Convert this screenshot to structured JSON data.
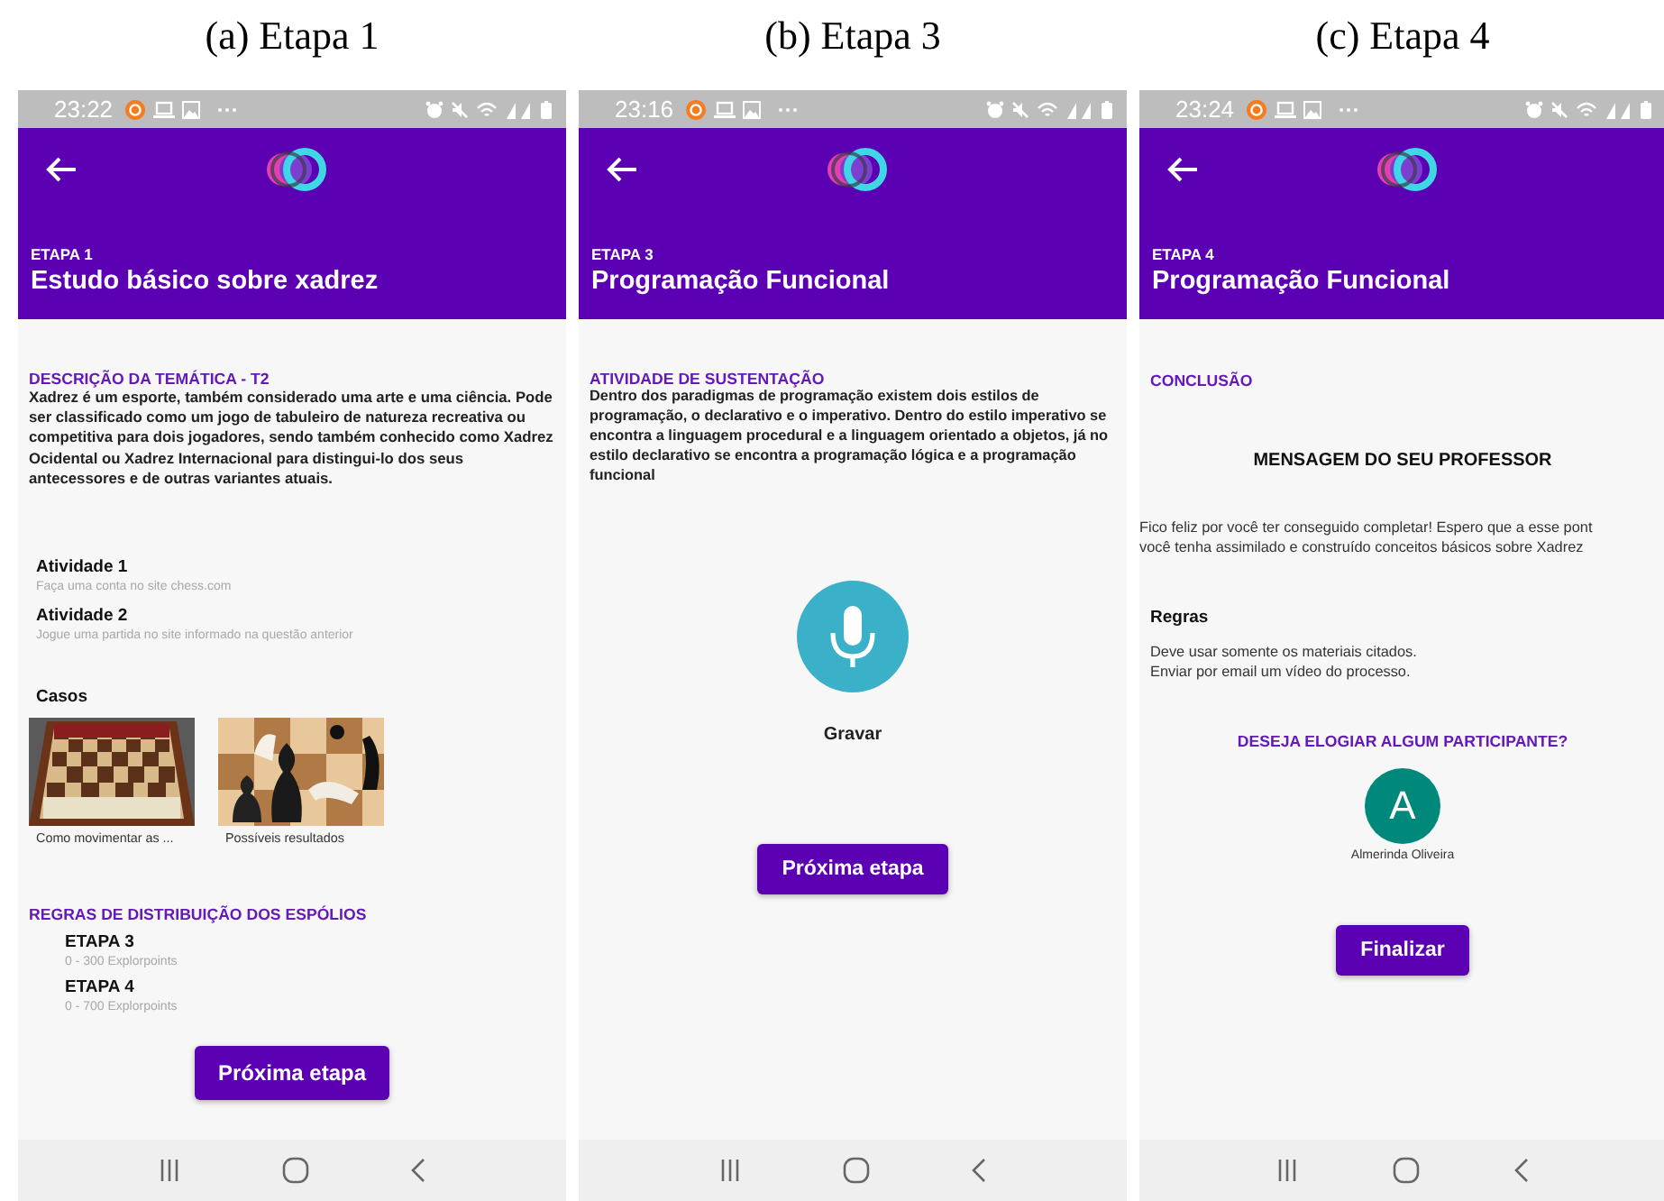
{
  "panels": [
    {
      "caption": "(a) Etapa 1",
      "status": {
        "time": "23:22"
      },
      "header": {
        "stage": "ETAPA 1",
        "title": "Estudo básico sobre xadrez"
      },
      "blocks": [
        {
          "kind": "section",
          "title": "DESCRIÇÃO DA TEMÁTICA - T2",
          "text": "Xadrez é um esporte, também considerado uma arte e uma ciência. Pode ser classificado como um jogo de tabuleiro de natureza recreativa ou competitiva para dois jogadores, sendo também conhecido como Xadrez Ocidental ou Xadrez Internacional para distingui-lo dos seus antecessores e de outras variantes atuais."
        },
        {
          "kind": "activities",
          "items": [
            {
              "title": "Atividade 1",
              "subtitle": "Faça uma conta no site chess.com"
            },
            {
              "title": "Atividade 2",
              "subtitle": "Jogue uma partida no site informado na questão anterior"
            }
          ]
        },
        {
          "kind": "cases",
          "title": "Casos",
          "items": [
            {
              "caption": "Como movimentar as ..."
            },
            {
              "caption": "Possíveis resultados"
            }
          ]
        },
        {
          "kind": "rewards",
          "title": "REGRAS DE DISTRIBUIÇÃO DOS ESPÓLIOS",
          "items": [
            {
              "title": "ETAPA 3",
              "subtitle": "0 - 300 Explorpoints"
            },
            {
              "title": "ETAPA 4",
              "subtitle": "0 - 700 Explorpoints"
            }
          ]
        },
        {
          "kind": "button",
          "label": "Próxima etapa"
        }
      ]
    },
    {
      "caption": "(b) Etapa 3",
      "status": {
        "time": "23:16"
      },
      "header": {
        "stage": "ETAPA 3",
        "title": "Programação Funcional"
      },
      "blocks": [
        {
          "kind": "section",
          "title": "ATIVIDADE DE SUSTENTAÇÃO",
          "text": "Dentro dos paradigmas de programação existem dois estilos de programação, o declarativo e o imperativo. Dentro do estilo imperativo se encontra a linguagem procedural e a linguagem orientado a objetos, já no estilo declarativo se encontra a programação lógica e a programação funcional"
        },
        {
          "kind": "record",
          "label": "Gravar"
        },
        {
          "kind": "button",
          "label": "Próxima etapa"
        }
      ]
    },
    {
      "caption": "(c) Etapa 4",
      "status": {
        "time": "23:24"
      },
      "header": {
        "stage": "ETAPA 4",
        "title": "Programação Funcional"
      },
      "blocks": [
        {
          "kind": "heading",
          "title": "CONCLUSÃO"
        },
        {
          "kind": "message",
          "title": "MENSAGEM DO SEU PROFESSOR",
          "lines": [
            "Fico feliz por você ter conseguido completar! Espero que a esse pont",
            "você tenha assimilado e construído conceitos básicos sobre Xadrez"
          ]
        },
        {
          "kind": "rules",
          "title": "Regras",
          "lines": [
            "Deve usar somente os materiais citados.",
            "Enviar por email um vídeo do processo."
          ]
        },
        {
          "kind": "praise",
          "title": "DESEJA ELOGIAR ALGUM PARTICIPANTE?",
          "participants": [
            {
              "initial": "A",
              "name": "Almerinda Oliveira"
            }
          ]
        },
        {
          "kind": "button",
          "label": "Finalizar"
        }
      ]
    }
  ]
}
